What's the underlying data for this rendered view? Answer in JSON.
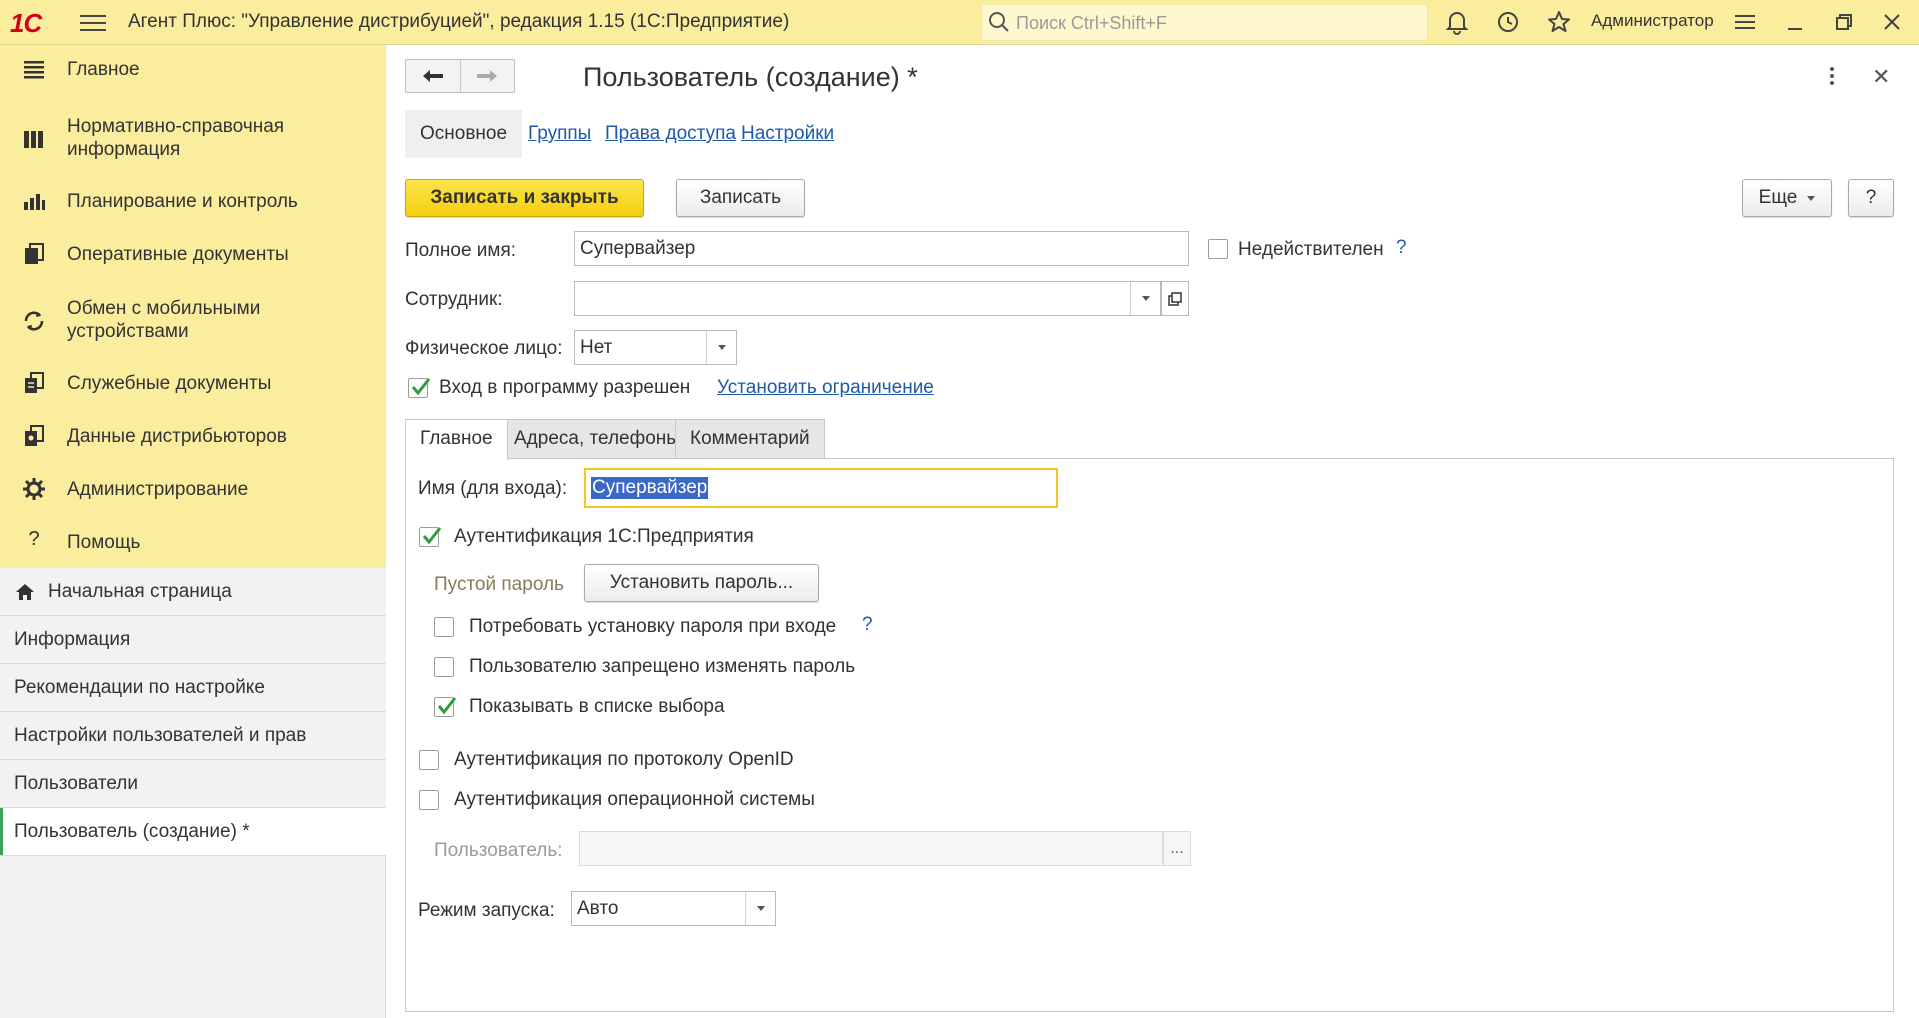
{
  "app": {
    "logo": "1С",
    "title": "Агент Плюс: \"Управление дистрибуцией\", редакция 1.15  (1С:Предприятие)",
    "search_placeholder": "Поиск Ctrl+Shift+F",
    "user": "Администратор"
  },
  "sidebar": {
    "sections": [
      {
        "label": "Главное",
        "icon": "menu-lines-icon"
      },
      {
        "label": "Нормативно-справочная информация",
        "icon": "catalog-icon"
      },
      {
        "label": "Планирование и контроль",
        "icon": "bar-chart-icon"
      },
      {
        "label": "Оперативные документы",
        "icon": "documents-icon"
      },
      {
        "label": "Обмен с мобильными устройствами",
        "icon": "sync-icon"
      },
      {
        "label": "Служебные документы",
        "icon": "service-docs-icon"
      },
      {
        "label": "Данные дистрибьюторов",
        "icon": "distributor-data-icon"
      },
      {
        "label": "Администрирование",
        "icon": "gear-icon"
      },
      {
        "label": "Помощь",
        "icon": "question-icon"
      }
    ],
    "open_windows": [
      {
        "label": "Начальная страница",
        "icon": "home-icon"
      },
      {
        "label": "Информация"
      },
      {
        "label": "Рекомендации по настройке"
      },
      {
        "label": "Настройки пользователей и прав"
      },
      {
        "label": "Пользователи"
      },
      {
        "label": "Пользователь (создание) *",
        "active": true
      }
    ]
  },
  "form": {
    "title": "Пользователь (создание) *",
    "tabs": [
      "Основное",
      "Группы",
      "Права доступа",
      "Настройки"
    ],
    "buttons": {
      "save_close": "Записать и закрыть",
      "save": "Записать",
      "more": "Еще",
      "help": "?"
    },
    "full_name_label": "Полное имя:",
    "full_name_value": "Супервайзер",
    "invalid_label": "Недействителен",
    "invalid_help": "?",
    "employee_label": "Сотрудник:",
    "employee_value": "",
    "person_label": "Физическое лицо:",
    "person_value": "Нет",
    "login_allowed_label": "Вход в программу разрешен",
    "set_restriction_link": "Установить ограничение",
    "inner_tabs": [
      "Главное",
      "Адреса, телефоны",
      "Комментарий"
    ],
    "login_name_label": "Имя (для входа):",
    "login_name_value": "Супервайзер",
    "auth_1c_label": "Аутентификация 1С:Предприятия",
    "empty_password_label": "Пустой пароль",
    "set_password_button": "Установить пароль...",
    "require_password_label": "Потребовать установку пароля при входе",
    "require_password_help": "?",
    "forbid_change_label": "Пользователю запрещено изменять пароль",
    "show_in_list_label": "Показывать в списке выбора",
    "openid_label": "Аутентификация по протоколу OpenID",
    "os_auth_label": "Аутентификация операционной системы",
    "os_user_label": "Пользователь:",
    "os_user_value": "",
    "os_user_button": "...",
    "launch_mode_label": "Режим запуска:",
    "launch_mode_value": "Авто"
  },
  "colors": {
    "topbar": "#fbed9e",
    "primary_button": "#f4cf10",
    "link": "#1d5aa8",
    "active_marker": "#3aa35b"
  }
}
